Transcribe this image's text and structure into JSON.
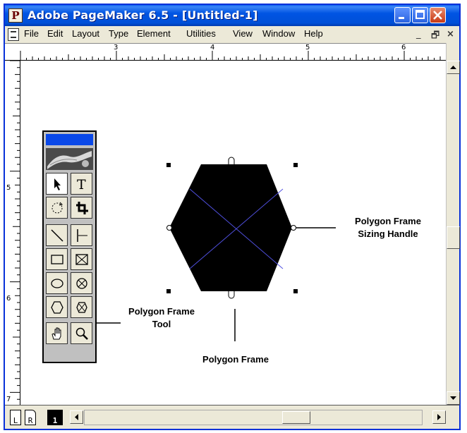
{
  "window": {
    "title": "Adobe PageMaker 6.5 - [Untitled-1]",
    "app_icon_letter": "P"
  },
  "menubar": {
    "items": [
      "File",
      "Edit",
      "Layout",
      "Type",
      "Element",
      "Utilities",
      "View",
      "Window",
      "Help"
    ],
    "mdi_minimize": "_",
    "mdi_restore": "🗗",
    "mdi_close": "×"
  },
  "rulers": {
    "horizontal_labels": [
      "3",
      "4",
      "5",
      "6"
    ],
    "vertical_labels": [
      "5",
      "6",
      "7"
    ]
  },
  "pages": {
    "left_label": "L",
    "right_label": "R",
    "current_page": "1"
  },
  "toolbox": {
    "tools": [
      [
        "pointer-tool",
        "text-tool"
      ],
      [
        "rotate-tool",
        "crop-tool"
      ],
      [
        "line-tool",
        "constrained-line-tool"
      ],
      [
        "rectangle-tool",
        "rectangle-frame-tool"
      ],
      [
        "ellipse-tool",
        "ellipse-frame-tool"
      ],
      [
        "polygon-tool",
        "polygon-frame-tool"
      ],
      [
        "hand-tool",
        "zoom-tool"
      ]
    ]
  },
  "callouts": {
    "sizing_handle_line1": "Polygon Frame",
    "sizing_handle_line2": "Sizing Handle",
    "frame_tool_line1": "Polygon Frame",
    "frame_tool_line2": "Tool",
    "frame": "Polygon Frame"
  },
  "colors": {
    "titlebar": "#0054e3",
    "toolbox_titlebar": "#0a48e8",
    "polygon_fill": "#000000",
    "frame_diagonals": "#4a4ad8",
    "close_button": "#c83a16"
  }
}
